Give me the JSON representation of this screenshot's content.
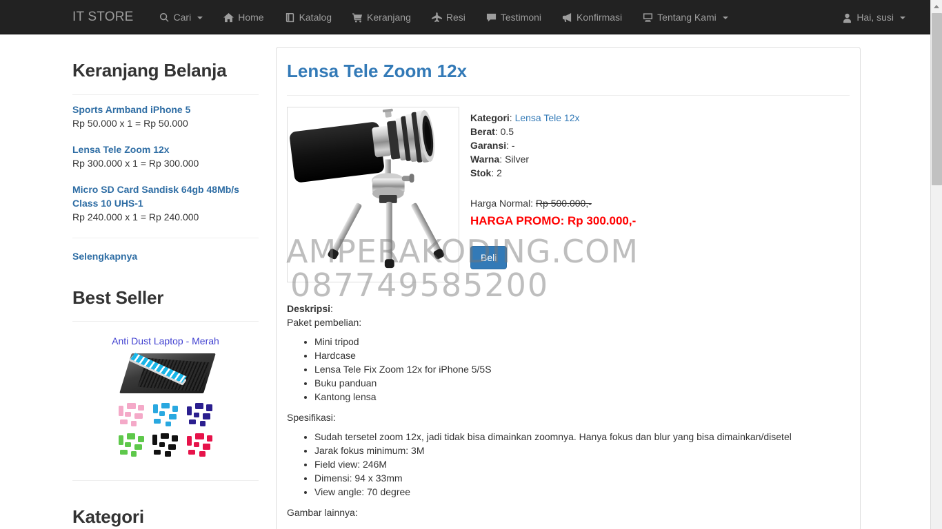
{
  "navbar": {
    "brand": "IT STORE",
    "items": [
      {
        "label": "Cari",
        "icon": "search-icon",
        "caret": true
      },
      {
        "label": "Home",
        "icon": "home-icon",
        "caret": false
      },
      {
        "label": "Katalog",
        "icon": "book-icon",
        "caret": false
      },
      {
        "label": "Keranjang",
        "icon": "cart-icon",
        "caret": false
      },
      {
        "label": "Resi",
        "icon": "plane-icon",
        "caret": false
      },
      {
        "label": "Testimoni",
        "icon": "comment-icon",
        "caret": false
      },
      {
        "label": "Konfirmasi",
        "icon": "bullhorn-icon",
        "caret": false
      },
      {
        "label": "Tentang Kami",
        "icon": "desktop-icon",
        "caret": true
      }
    ],
    "user": {
      "label": "Hai, susi",
      "icon": "user-icon",
      "caret": true
    }
  },
  "sidebar": {
    "cart_heading": "Keranjang Belanja",
    "cart_items": [
      {
        "name": "Sports Armband iPhone 5",
        "calc": "Rp 50.000 x 1 = Rp 50.000"
      },
      {
        "name": "Lensa Tele Zoom 12x",
        "calc": "Rp 300.000 x 1 = Rp 300.000"
      },
      {
        "name": "Micro SD Card Sandisk 64gb 48Mb/s Class 10 UHS-1",
        "calc": "Rp 240.000 x 1 = Rp 240.000"
      }
    ],
    "more_link": "Selengkapnya",
    "bestseller_heading": "Best Seller",
    "bestseller_product": "Anti Dust Laptop - Merah",
    "kategori_heading": "Kategori"
  },
  "product": {
    "title": "Lensa Tele Zoom 12x",
    "meta": [
      {
        "label": "Kategori",
        "value": "Lensa Tele 12x",
        "is_link": true
      },
      {
        "label": "Berat",
        "value": "0.5",
        "is_link": false
      },
      {
        "label": "Garansi",
        "value": "-",
        "is_link": false
      },
      {
        "label": "Warna",
        "value": "Silver",
        "is_link": false
      },
      {
        "label": "Stok",
        "value": "2",
        "is_link": false
      }
    ],
    "harga_normal_label": "Harga Normal:",
    "harga_normal_value": "Rp 500.000,-",
    "harga_promo": "HARGA PROMO: Rp 300.000,-",
    "buy_button": "Beli",
    "deskripsi_label": "Deskripsi",
    "paket_label": "Paket pembelian:",
    "paket_items": [
      "Mini tripod",
      "Hardcase",
      "Lensa Tele Fix Zoom 12x for iPhone 5/5S",
      "Buku panduan",
      "Kantong lensa"
    ],
    "spesifikasi_label": "Spesifikasi:",
    "spesifikasi_items": [
      "Sudah tersetel zoom 12x, jadi tidak bisa dimainkan zoomnya. Hanya fokus dan blur yang bisa dimainkan/disetel",
      "Jarak fokus minimum: 3M",
      "Field view: 246M",
      "Dimensi: 94 x 33mm",
      "View angle: 70 degree"
    ],
    "gambar_lainnya_label": "Gambar lainnya:"
  },
  "watermark": {
    "line1": "AMPERAKODING.COM",
    "line2": "087749585200"
  },
  "colors": {
    "navbar_bg": "#222222",
    "nav_text": "#9d9d9d",
    "link_blue": "#337ab7",
    "sidebar_link": "#2e6da4",
    "promo_red": "#ff0000",
    "button_blue": "#337ab7"
  }
}
